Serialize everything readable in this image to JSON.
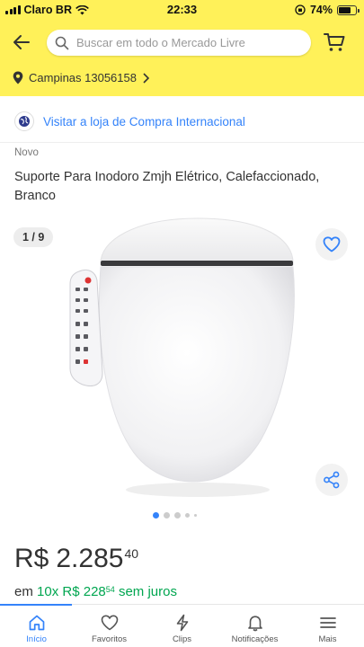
{
  "status_bar": {
    "carrier": "Claro BR",
    "time": "22:33",
    "battery": "74%",
    "battery_level": 0.74
  },
  "header": {
    "search_placeholder": "Buscar em todo o Mercado Livre",
    "location": "Campinas 13056158"
  },
  "store": {
    "link_text": "Visitar a loja de Compra Internacional"
  },
  "product": {
    "condition": "Novo",
    "title": "Suporte Para Inodoro Zmjh Elétrico, Calefaccionado, Branco",
    "gallery_counter": "1 / 9",
    "price_currency": "R$",
    "price_value": "2.285",
    "price_cents": "40",
    "installments_prefix": "em",
    "installments_count": "10x",
    "installments_currency": "R$",
    "installments_value": "228",
    "installments_cents": "54",
    "installments_suffix": "sem juros"
  },
  "colors": {
    "header_yellow": "#fff159",
    "link_blue": "#3483fa",
    "installment_green": "#00a650"
  },
  "tabbar": {
    "items": [
      {
        "label": "Início",
        "icon": "home-icon"
      },
      {
        "label": "Favoritos",
        "icon": "heart-icon"
      },
      {
        "label": "Clips",
        "icon": "clips-icon"
      },
      {
        "label": "Notificações",
        "icon": "bell-icon"
      },
      {
        "label": "Mais",
        "icon": "menu-icon"
      }
    ]
  }
}
